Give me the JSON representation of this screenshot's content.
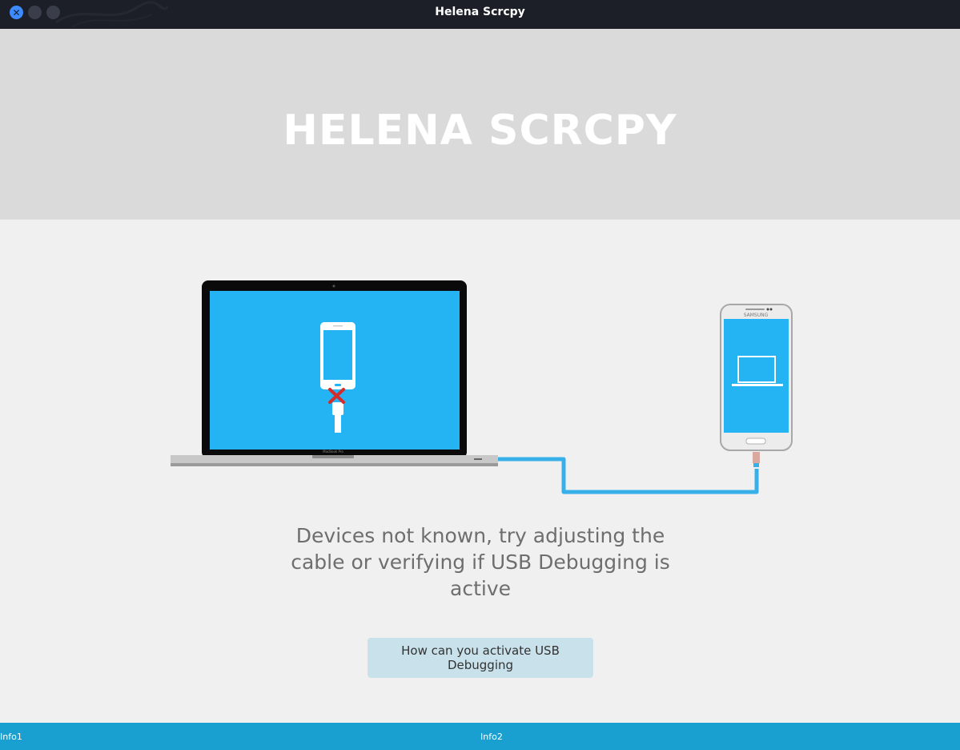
{
  "window": {
    "title": "Helena Scrcpy"
  },
  "banner": {
    "heading": "HELENA SCRCPY"
  },
  "illustration": {
    "laptop_badge": "MacBook Pro",
    "phone_brand": "SAMSUNG",
    "screen_color": "#24b4f4",
    "cable_color": "#37afe8",
    "error_color": "#d62b2b"
  },
  "main": {
    "message": "Devices not known, try adjusting the cable or verifying if USB Debugging is active",
    "help_button_label": "How can you activate USB Debugging"
  },
  "statusbar": {
    "info1": "Info1",
    "info2": "Info2",
    "color": "#1aa0d0"
  },
  "colors": {
    "titlebar": "#1c1f27",
    "close_button": "#3d8bff",
    "banner": "#dbdadb",
    "body": "#f0f0f0",
    "button_bg": "#c8e1ea"
  }
}
